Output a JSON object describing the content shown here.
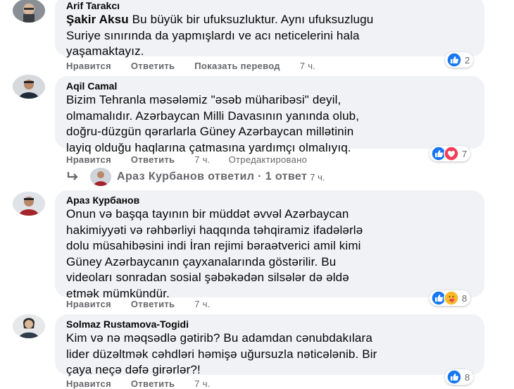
{
  "comments": [
    {
      "author": "Arif Tarakcı",
      "tag": "Şakir Aksu",
      "text": "Bu büyük bir ufuksuzluktur. Aynı ufuksuzlugu\nSuriye sınırında da yapmışlardı ve acı neticelerini hala\nyaşamaktayız.",
      "actions": {
        "like": "Нравится",
        "reply": "Ответить",
        "translate": "Показать перевод",
        "time": "7 ч."
      },
      "reactions": {
        "icons": [
          "like-icon"
        ],
        "count": "2"
      }
    },
    {
      "author": "Aqil Camal",
      "text": "Bizim Tehranla məsələmiz \"əsəb müharibəsi\" deyil,\nolmamalıdır. Azərbaycan Milli Davasının yanında olub,\ndoğru-düzgün qərarlarla Güney Azərbaycan millətinin\nlayiq olduğu haqlarına çatmasına yardımçı olmalıyıq.",
      "actions": {
        "like": "Нравится",
        "reply": "Ответить",
        "time": "7 ч.",
        "edited": "Отредактировано"
      },
      "reactions": {
        "icons": [
          "like-icon",
          "love-icon"
        ],
        "count": "7"
      }
    },
    {
      "author": "Араз Курбанов",
      "text": "Onun və başqa tayının bir müddət əvvəl Azərbaycan\nhakimiyyəti və rəhbərliyi haqqında təhqiramiz ifadələrlə\ndolu müsahibəsini indi İran rejimi bəraətverici amil kimi\nGüney Azərbaycanın çayxanalarında göstərilir. Bu\nvideoları sonradan sosial şəbəkədən silsələr də əldə\netmək mümkündür.",
      "actions": {
        "like": "Нравится",
        "reply": "Ответить",
        "time": "7 ч."
      },
      "reactions": {
        "icons": [
          "like-icon",
          "care-icon"
        ],
        "count": "8"
      }
    },
    {
      "author": "Solmaz Rustamova-Togidi",
      "text": "Kim və nə məqsədlə gətirib? Bu adamdan cənubdakılara\nlider düzəltmək cəhdləri həmişə uğursuzla nəticələnib. Bir\nçaya neçə dəfə girərlər?!",
      "actions": {
        "like": "Нравится",
        "reply": "Ответить",
        "time": "7 ч."
      },
      "reactions": {
        "icons": [
          "like-icon"
        ],
        "count": "8"
      }
    }
  ],
  "reply_summary": {
    "text": "Араз Курбанов ответил · 1 ответ",
    "time": "7 ч."
  },
  "colors": {
    "bubble": "#f0f2f5",
    "secondary_text": "#65676b",
    "like_blue": "#1877f2",
    "love_red": "#f33e58",
    "care_yellow": "#f7b928"
  }
}
